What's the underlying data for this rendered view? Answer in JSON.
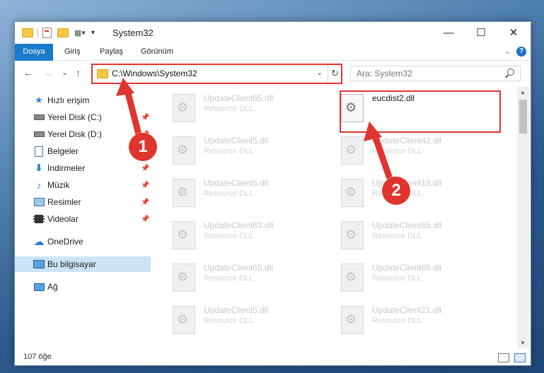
{
  "window": {
    "title": "System32",
    "controls": {
      "minimize": "—",
      "maximize": "☐",
      "close": "✕"
    }
  },
  "ribbon": {
    "tabs": [
      "Dosya",
      "Giriş",
      "Paylaş",
      "Görünüm"
    ],
    "help": "?"
  },
  "nav": {
    "back": "←",
    "forward": "→",
    "recent": "⌄",
    "up": "↑",
    "address": "C:\\Windows\\System32",
    "refresh": "↻",
    "search_placeholder": "Ara: System32"
  },
  "sidebar": {
    "items": [
      {
        "label": "Hızlı erişim",
        "icon": "star-icon"
      },
      {
        "label": "Yerel Disk (C:)",
        "icon": "drive-icon",
        "pinned": true
      },
      {
        "label": "Yerel Disk (D:)",
        "icon": "drive-icon",
        "pinned": true
      },
      {
        "label": "Belgeler",
        "icon": "documents-icon",
        "pinned": true
      },
      {
        "label": "İndirmeler",
        "icon": "download-icon",
        "pinned": true
      },
      {
        "label": "Müzik",
        "icon": "music-icon",
        "pinned": true
      },
      {
        "label": "Resimler",
        "icon": "pictures-icon",
        "pinned": true
      },
      {
        "label": "Videolar",
        "icon": "videos-icon",
        "pinned": true
      },
      {
        "label": "OneDrive",
        "icon": "cloud-icon"
      },
      {
        "label": "Bu bilgisayar",
        "icon": "computer-icon",
        "selected": true
      },
      {
        "label": "Ağ",
        "icon": "network-icon"
      }
    ]
  },
  "files": {
    "left": [
      {
        "name": "UpdateClient65.dll",
        "type": "Resource DLL"
      },
      {
        "name": "UpdateClient5.dll",
        "type": "Resource DLL"
      },
      {
        "name": "UpdateClient5.dll",
        "type": "Resource DLL"
      },
      {
        "name": "UpdateClient63.dll",
        "type": "Resource DLL"
      },
      {
        "name": "UpdateClient65.dll",
        "type": "Resource DLL"
      },
      {
        "name": "UpdateClient5.dll",
        "type": "Resource DLL"
      }
    ],
    "right": [
      {
        "name": "eucdist2.dll",
        "type": "",
        "highlighted": true
      },
      {
        "name": "UpdateClient42.dll",
        "type": "Resource DLL"
      },
      {
        "name": "UpdateClient19.dll",
        "type": "Resource DLL"
      },
      {
        "name": "UpdateClient65.dll",
        "type": "Resource DLL"
      },
      {
        "name": "UpdateClient65.dll",
        "type": "Resource DLL"
      },
      {
        "name": "UpdateClient21.dll",
        "type": "Resource DLL"
      }
    ]
  },
  "status": {
    "item_count": "107 öğe"
  },
  "annotations": {
    "step1": "1",
    "step2": "2",
    "color": "#e0342e"
  }
}
